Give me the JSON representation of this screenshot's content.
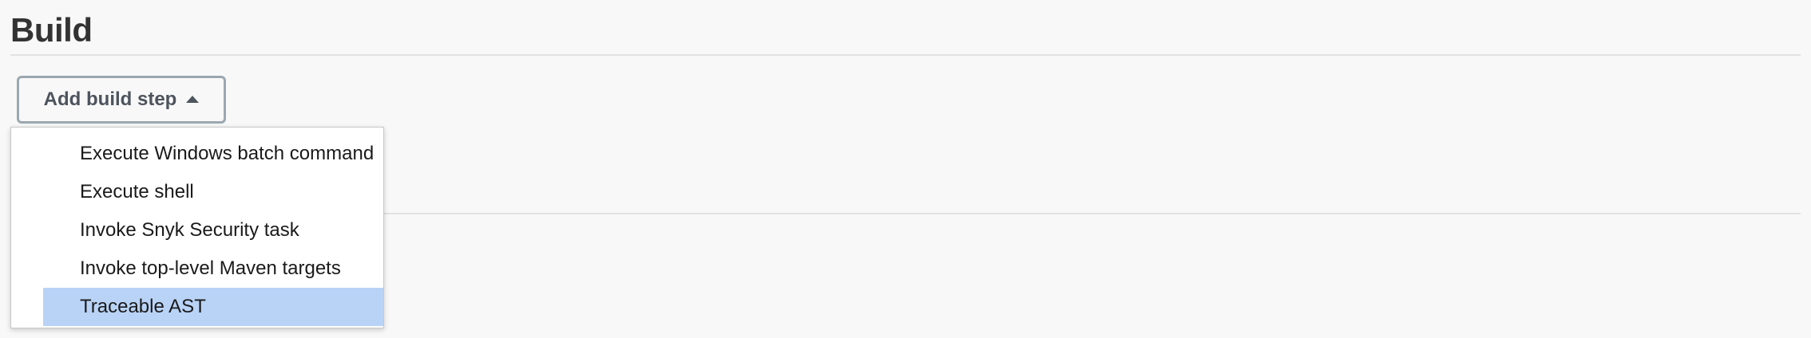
{
  "section": {
    "title": "Build"
  },
  "add_build_step": {
    "label": "Add build step",
    "icon": "caret-up-icon",
    "expanded": true
  },
  "menu": {
    "items": [
      {
        "label": "Execute Windows batch command",
        "selected": false
      },
      {
        "label": "Execute shell",
        "selected": false
      },
      {
        "label": "Invoke Snyk Security task",
        "selected": false
      },
      {
        "label": "Invoke top-level Maven targets",
        "selected": false
      },
      {
        "label": "Traceable AST",
        "selected": true
      }
    ],
    "highlight_color": "#b9d3f7"
  },
  "colors": {
    "background": "#f8f8f8",
    "button_border": "#9ba7af",
    "button_text": "#4d545d",
    "title_text": "#333333"
  }
}
